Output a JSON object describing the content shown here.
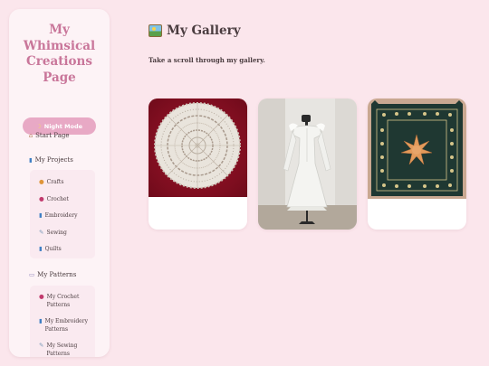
{
  "sidebar": {
    "title_lines": [
      "My",
      "Whimsical",
      "Creations",
      "Page"
    ],
    "night_mode": {
      "icon": "moon-icon",
      "label": "Night Mode"
    },
    "start_page": {
      "icon": "house-icon",
      "label": "Start Page"
    },
    "my_projects": {
      "icon": "spool-icon",
      "label": "My Projects",
      "items": [
        {
          "icon": "palette-icon",
          "label": "Crafts"
        },
        {
          "icon": "yarn-ball-icon",
          "label": "Crochet"
        },
        {
          "icon": "spool-icon",
          "label": "Embroidery"
        },
        {
          "icon": "needle-icon",
          "label": "Sewing"
        },
        {
          "icon": "spool-icon",
          "label": "Quilts"
        }
      ]
    },
    "my_patterns": {
      "icon": "book-icon",
      "label": "My Patterns",
      "items": [
        {
          "icon": "yarn-ball-icon",
          "label": "My Crochet Patterns"
        },
        {
          "icon": "spool-icon",
          "label": "My Embroidery Patterns"
        },
        {
          "icon": "needle-icon",
          "label": "My Sewing Patterns"
        }
      ]
    }
  },
  "main": {
    "heading_icon": "framed-picture-icon",
    "heading": "My Gallery",
    "subtitle": "Take a scroll through my gallery."
  },
  "gallery": [
    {
      "image": "white-crochet-doily-on-red-background"
    },
    {
      "image": "white-dress-on-mannequin"
    },
    {
      "image": "dark-green-embroidered-celestial-sun-tapestry"
    }
  ],
  "colors": {
    "page_background": "#fbe6ec",
    "sidebar_background": "#fdf3f6",
    "title_accent": "#c9769a",
    "night_mode_button": "#e8a9c5",
    "submenu_background": "#faeaf0"
  }
}
